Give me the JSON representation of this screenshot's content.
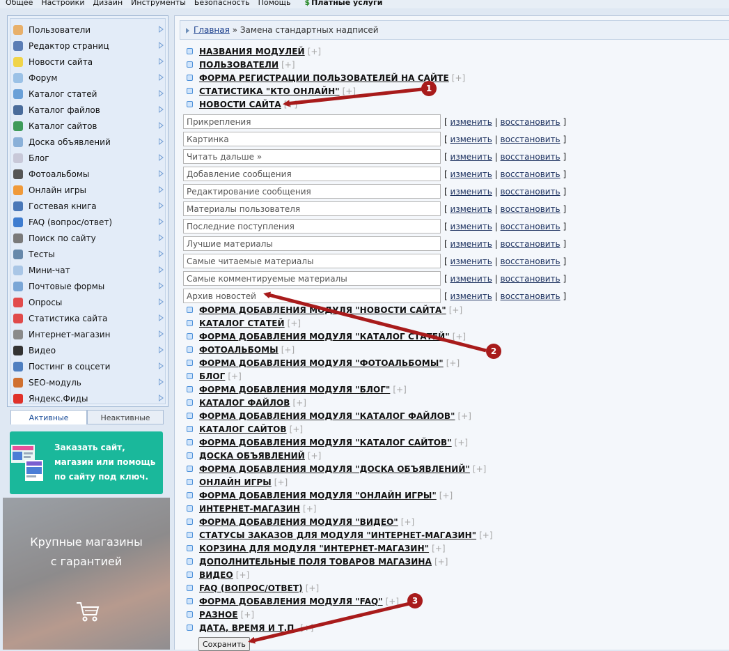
{
  "top_menu": [
    "Общее",
    "Настройки",
    "Дизайн",
    "Инструменты",
    "Безопасность",
    "Помощь"
  ],
  "top_menu_paid": "Платные услуги",
  "sidebar": {
    "items": [
      {
        "label": "Пользователи",
        "icon": "user-icon",
        "color": "#e8b06b"
      },
      {
        "label": "Редактор страниц",
        "icon": "edit-icon",
        "color": "#5b7db5"
      },
      {
        "label": "Новости сайта",
        "icon": "bulb-icon",
        "color": "#f0d44a"
      },
      {
        "label": "Форум",
        "icon": "forum-icon",
        "color": "#9bc1e6"
      },
      {
        "label": "Каталог статей",
        "icon": "articles-icon",
        "color": "#6aa0d8"
      },
      {
        "label": "Каталог файлов",
        "icon": "floppy-icon",
        "color": "#4a6c9b"
      },
      {
        "label": "Каталог сайтов",
        "icon": "globe-icon",
        "color": "#3e9b5a"
      },
      {
        "label": "Доска объявлений",
        "icon": "board-icon",
        "color": "#8ab0d8"
      },
      {
        "label": "Блог",
        "icon": "blog-icon",
        "color": "#c8c8d8"
      },
      {
        "label": "Фотоальбомы",
        "icon": "camera-icon",
        "color": "#555555"
      },
      {
        "label": "Онлайн игры",
        "icon": "games-icon",
        "color": "#f09a3a"
      },
      {
        "label": "Гостевая книга",
        "icon": "book-icon",
        "color": "#4a78b8"
      },
      {
        "label": "FAQ (вопрос/ответ)",
        "icon": "question-icon",
        "color": "#3f7dd0"
      },
      {
        "label": "Поиск по сайту",
        "icon": "search-icon",
        "color": "#7a7a7a"
      },
      {
        "label": "Тесты",
        "icon": "tests-icon",
        "color": "#6688aa"
      },
      {
        "label": "Мини-чат",
        "icon": "chat-icon",
        "color": "#a9c6e6"
      },
      {
        "label": "Почтовые формы",
        "icon": "mail-icon",
        "color": "#7aa6d6"
      },
      {
        "label": "Опросы",
        "icon": "poll-icon",
        "color": "#e24b4b"
      },
      {
        "label": "Статистика сайта",
        "icon": "stats-icon",
        "color": "#e04a4a"
      },
      {
        "label": "Интернет-магазин",
        "icon": "shop-icon",
        "color": "#8a8a8a"
      },
      {
        "label": "Видео",
        "icon": "video-icon",
        "color": "#333333"
      },
      {
        "label": "Постинг в соцсети",
        "icon": "social-icon",
        "color": "#4f7fc0"
      },
      {
        "label": "SEO-модуль",
        "icon": "seo-icon",
        "color": "#d07030"
      },
      {
        "label": "Яндекс.Фиды",
        "icon": "yandex-icon",
        "color": "#e0312a"
      }
    ]
  },
  "tabs": {
    "active": "Активные",
    "inactive": "Неактивные"
  },
  "promo": {
    "text": "Заказать сайт, магазин или помощь по сайту под ключ."
  },
  "banner": {
    "line1": "Крупные магазины",
    "line2": "с гарантией"
  },
  "breadcrumb": {
    "home": "Главная",
    "separator": "»",
    "current": "Замена стандартных надписей"
  },
  "toggle_label": "[+]",
  "modules_before": [
    "НАЗВАНИЯ МОДУЛЕЙ",
    "ПОЛЬЗОВАТЕЛИ",
    "ФОРМА РЕГИСТРАЦИИ ПОЛЬЗОВАТЕЛЕЙ НА САЙТЕ",
    "СТАТИСТИКА \"КТО ОНЛАЙН\"",
    "НОВОСТИ САЙТА"
  ],
  "news_fields": [
    "Прикрепления",
    "Картинка",
    "Читать дальше »",
    "Добавление сообщения",
    "Редактирование сообщения",
    "Материалы пользователя",
    "Последние поступления",
    "Лучшие материалы",
    "Самые читаемые материалы",
    "Самые комментируемые материалы",
    "Архив новостей"
  ],
  "field_actions": {
    "open": "[",
    "change": "изменить",
    "sep": "|",
    "restore": "восстановить",
    "close": "]"
  },
  "modules_after": [
    "ФОРМА ДОБАВЛЕНИЯ МОДУЛЯ \"НОВОСТИ САЙТА\"",
    "КАТАЛОГ СТАТЕЙ",
    "ФОРМА ДОБАВЛЕНИЯ МОДУЛЯ \"КАТАЛОГ СТАТЕЙ\"",
    "ФОТОАЛЬБОМЫ",
    "ФОРМА ДОБАВЛЕНИЯ МОДУЛЯ \"ФОТОАЛЬБОМЫ\"",
    "БЛОГ",
    "ФОРМА ДОБАВЛЕНИЯ МОДУЛЯ \"БЛОГ\"",
    "КАТАЛОГ ФАЙЛОВ",
    "ФОРМА ДОБАВЛЕНИЯ МОДУЛЯ \"КАТАЛОГ ФАЙЛОВ\"",
    "КАТАЛОГ САЙТОВ",
    "ФОРМА ДОБАВЛЕНИЯ МОДУЛЯ \"КАТАЛОГ САЙТОВ\"",
    "ДОСКА ОБЪЯВЛЕНИЙ",
    "ФОРМА ДОБАВЛЕНИЯ МОДУЛЯ \"ДОСКА ОБЪЯВЛЕНИЙ\"",
    "ОНЛАЙН ИГРЫ",
    "ФОРМА ДОБАВЛЕНИЯ МОДУЛЯ \"ОНЛАЙН ИГРЫ\"",
    "ИНТЕРНЕТ-МАГАЗИН",
    "ФОРМА ДОБАВЛЕНИЯ МОДУЛЯ \"ВИДЕО\"",
    "СТАТУСЫ ЗАКАЗОВ ДЛЯ МОДУЛЯ \"ИНТЕРНЕТ-МАГАЗИН\"",
    "КОРЗИНА ДЛЯ МОДУЛЯ \"ИНТЕРНЕТ-МАГАЗИН\"",
    "ДОПОЛНИТЕЛЬНЫЕ ПОЛЯ ТОВАРОВ МАГАЗИНА",
    "ВИДЕО",
    "FAQ (ВОПРОС/ОТВЕТ)",
    "ФОРМА ДОБАВЛЕНИЯ МОДУЛЯ \"FAQ\"",
    "РАЗНОЕ",
    "ДАТА, ВРЕМЯ И Т.П."
  ],
  "save_label": "Сохранить",
  "markers": [
    "1",
    "2",
    "3"
  ],
  "colors": {
    "marker": "#a81b1b",
    "link": "#1a3e8c",
    "promo": "#1ab89b"
  }
}
